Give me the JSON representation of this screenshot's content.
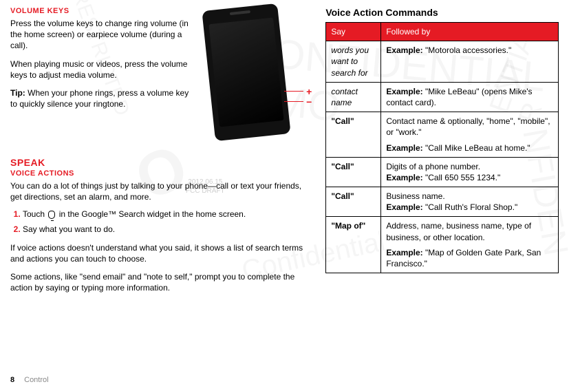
{
  "left": {
    "vol_heading": "VOLUME KEYS",
    "vol_p1": "Press the volume keys to change ring volume (in the home screen) or earpiece volume (during a call).",
    "vol_p2": "When playing music or videos, press the volume keys to adjust media volume.",
    "vol_tip_label": "Tip:",
    "vol_tip": " When your phone rings, press a volume key to quickly silence your ringtone.",
    "speak_heading": "SPEAK",
    "va_heading": "VOICE ACTIONS",
    "va_intro": "You can do a lot of things just by talking to your phone—call or text your friends, get directions, set an alarm, and more.",
    "step1_pre": "Touch ",
    "step1_post": " in the Google™ Search widget in the home screen.",
    "step2": "Say what you want to do.",
    "va_post1": "If voice actions doesn't understand what you said, it shows a list of search terms and actions you can touch to choose.",
    "va_post2": "Some actions, like \"send email\" and \"note to self,\" prompt you to complete the action by saying or typing more information."
  },
  "right": {
    "title": "Voice Action Commands",
    "header_say": "Say",
    "header_follow": "Followed by",
    "rows": [
      {
        "say": "words you want to search for",
        "say_style": "italic",
        "ex_pre": "Example:",
        "ex": " \"Motorola accessories.\""
      },
      {
        "say": "contact name",
        "say_style": "italic",
        "ex_pre": "Example:",
        "ex": " \"Mike LeBeau\" (opens Mike's contact card)."
      },
      {
        "say": "\"Call\"",
        "say_style": "bold",
        "body": "Contact name & optionally, \"home\", \"mobile\", or \"work.\"",
        "ex_pre": "Example:",
        "ex": " \"Call Mike LeBeau at home.\""
      },
      {
        "say": "\"Call\"",
        "say_style": "bold",
        "body": "Digits of a phone number.",
        "ex_pre": "Example:",
        "ex": " \"Call 650 555 1234.\""
      },
      {
        "say": "\"Call\"",
        "say_style": "bold",
        "body": "Business name.",
        "ex_pre": "Example:",
        "ex": " \"Call Ruth's Floral Shop.\""
      },
      {
        "say": "\"Map of\"",
        "say_style": "bold",
        "body": "Address, name, business name, type of business, or other location.",
        "ex_pre": "Example:",
        "ex": " \"Map of Golden Gate Park, San Francisco.\""
      }
    ]
  },
  "draft": {
    "date": "2012.06.15",
    "label": "FCC DRAFT"
  },
  "footer": {
    "page": "8",
    "section": "Control"
  }
}
